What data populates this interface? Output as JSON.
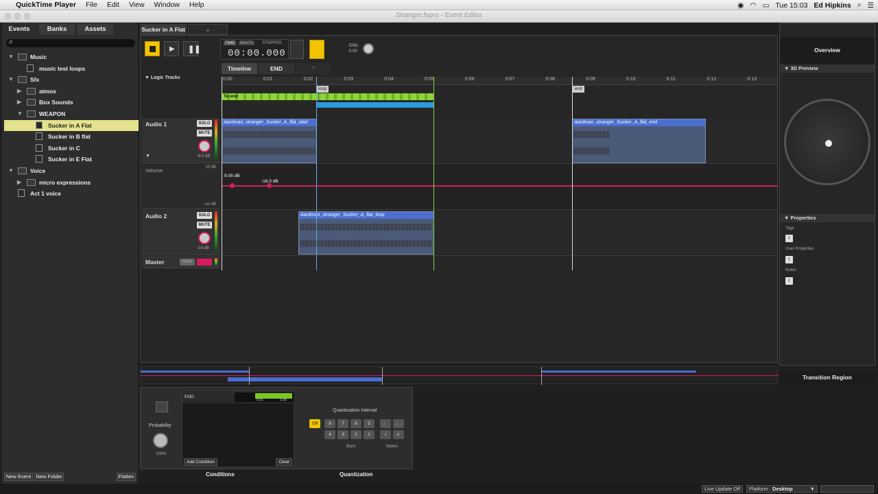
{
  "menubar": {
    "app": "QuickTime Player",
    "items": [
      "File",
      "Edit",
      "View",
      "Window",
      "Help"
    ],
    "clock": "Tue 15:03",
    "user": "Ed Hipkins"
  },
  "window": {
    "title": "Stranger.fspro - Event Editor"
  },
  "left": {
    "tabs": [
      "Events",
      "Banks",
      "Assets"
    ],
    "tree": [
      {
        "label": "Music",
        "type": "folder",
        "level": 0,
        "arrow": "▼"
      },
      {
        "label": "music test loops",
        "type": "event",
        "level": 1,
        "arrow": ""
      },
      {
        "label": "Sfx",
        "type": "folder",
        "level": 0,
        "arrow": "▼"
      },
      {
        "label": "atmos",
        "type": "folder",
        "level": 1,
        "arrow": "▶"
      },
      {
        "label": "Box Sounds",
        "type": "folder",
        "level": 1,
        "arrow": "▶"
      },
      {
        "label": "WEAPON",
        "type": "folder",
        "level": 1,
        "arrow": "▼"
      },
      {
        "label": "Sucker in A Flat",
        "type": "event",
        "level": 2,
        "arrow": "",
        "selected": true
      },
      {
        "label": "Sucker in B flat",
        "type": "event",
        "level": 2,
        "arrow": ""
      },
      {
        "label": "Sucker in C",
        "type": "event",
        "level": 2,
        "arrow": ""
      },
      {
        "label": "Sucker in E Flat",
        "type": "event",
        "level": 2,
        "arrow": ""
      },
      {
        "label": "Voice",
        "type": "folder",
        "level": 0,
        "arrow": "▼"
      },
      {
        "label": "micro expressions",
        "type": "folder",
        "level": 1,
        "arrow": "▶"
      },
      {
        "label": "Act 1 voice",
        "type": "event",
        "level": 0,
        "arrow": ""
      }
    ],
    "buttons": {
      "new_event": "New Event",
      "new_folder": "New Folder",
      "flatten": "Flatten"
    }
  },
  "editor": {
    "tab": "Sucker in A Flat",
    "transport": {
      "time_label": "TIME",
      "beats_label": "BEATS",
      "state": "STOPPED",
      "time": "00:00.000",
      "end_label": "END",
      "end_value": "0.00"
    },
    "subtabs": [
      "Timeline",
      "END"
    ],
    "logic_tracks": "Logic Tracks",
    "ruler": [
      "0:00",
      "0:01",
      "0:02",
      "0:03",
      "0:04",
      "0:05",
      "0:06",
      "0:07",
      "0:08",
      "0:09",
      "0:10",
      "0:11",
      "0:12",
      "0:13"
    ],
    "markers": {
      "loop": "loop",
      "end": "end",
      "to_end": "To end"
    },
    "tracks": [
      {
        "name": "Audio 1",
        "solo": "SOLO",
        "mute": "MUTE",
        "gain": "-9.0 dB"
      },
      {
        "name": "Audio 2",
        "solo": "SOLO",
        "mute": "MUTE",
        "gain": "-16 dB"
      }
    ],
    "volume": {
      "label": "Volume",
      "top": "10 dB",
      "bottom": "-oo dB",
      "p1": "-9.05 dB",
      "p2": "-16.0 dB"
    },
    "master": {
      "label": "Master",
      "mon": "MON"
    },
    "regions": {
      "start": "Aardman_stranger_Sucker_A_flat_start",
      "end": "Aardman_stranger_Sucker_A_flat_end",
      "loop": "Aardman_stranger_Sucker_A_flat_loop"
    }
  },
  "right": {
    "overview": "Overview",
    "preview": "3D Preview",
    "properties": "Properties",
    "tags": "Tags",
    "user_props": "User Properties",
    "notes": "Notes",
    "transition": "Transition Region"
  },
  "bottom": {
    "probability": "Probability",
    "prob_value": "100%",
    "cond_label": "END",
    "cond_v1": "0.01",
    "cond_v2": "1.00",
    "add_condition": "Add Condition",
    "clear": "Clear",
    "conditions": "Conditions",
    "quant_title": "Quantization Interval",
    "off": "Off",
    "bars_row1": [
      "8",
      "7",
      "6",
      "5"
    ],
    "bars_row2": [
      "4",
      "3",
      "2",
      "1"
    ],
    "bars": "Bars",
    "notes": "Notes",
    "quantization": "Quantization"
  },
  "status": {
    "live_update": "Live Update Off",
    "platform_label": "Platform",
    "platform": "Desktop"
  }
}
